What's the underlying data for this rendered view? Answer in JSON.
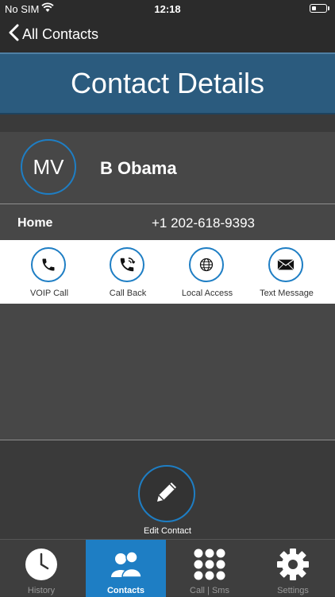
{
  "status_bar": {
    "carrier": "No SIM",
    "time": "12:18"
  },
  "nav": {
    "back_label": "All Contacts"
  },
  "page_title": "Contact Details",
  "contact": {
    "initials": "MV",
    "name": "B Obama",
    "phone_label": "Home",
    "phone_number": "+1 202-618-9393"
  },
  "actions": [
    {
      "label": "VOIP Call",
      "icon": "phone-icon"
    },
    {
      "label": "Call Back",
      "icon": "callback-icon"
    },
    {
      "label": "Local Access",
      "icon": "globe-icon"
    },
    {
      "label": "Text Message",
      "icon": "envelope-icon"
    }
  ],
  "edit": {
    "label": "Edit Contact",
    "icon": "pencil-icon"
  },
  "tabs": [
    {
      "label": "History",
      "icon": "clock-icon",
      "active": false
    },
    {
      "label": "Contacts",
      "icon": "people-icon",
      "active": true
    },
    {
      "label": "Call | Sms",
      "icon": "keypad-icon",
      "active": false
    },
    {
      "label": "Settings",
      "icon": "gear-icon",
      "active": false
    }
  ],
  "colors": {
    "accent": "#1e7ec4",
    "banner": "#2b5b7e",
    "background": "#3a3a3a",
    "row": "#474747"
  }
}
